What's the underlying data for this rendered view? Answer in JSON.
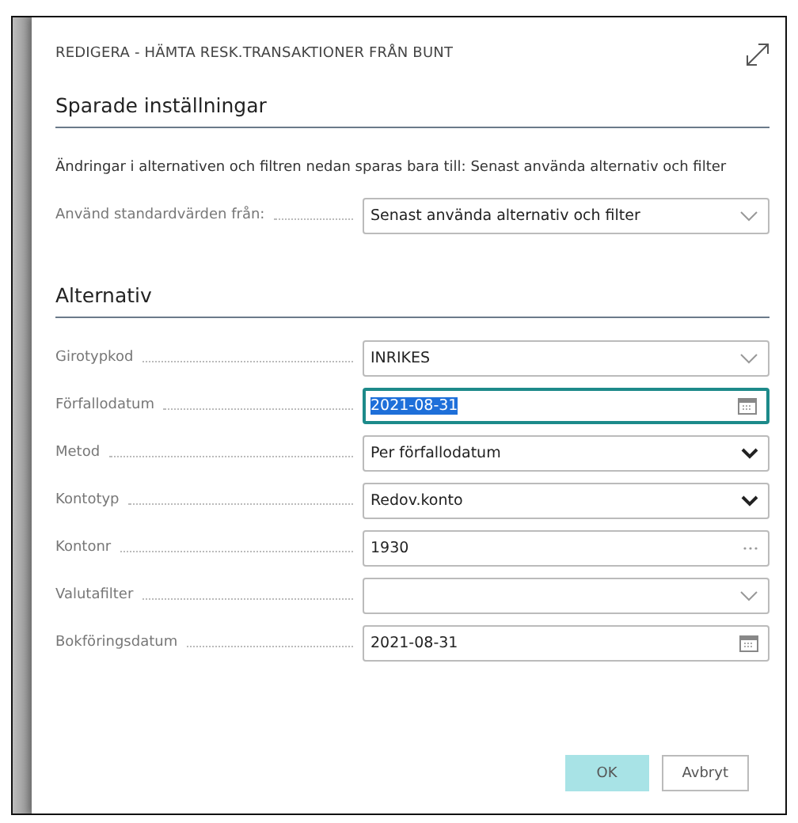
{
  "dialog": {
    "title": "REDIGERA - HÄMTA RESK.TRANSAKTIONER FRÅN BUNT"
  },
  "saved_settings": {
    "heading": "Sparade inställningar",
    "info": "Ändringar i alternativen och filtren nedan sparas bara till: Senast använda alternativ och filter",
    "default_field": {
      "label": "Använd standardvärden från:",
      "value": "Senast använda alternativ och filter",
      "kind": "dropdown"
    }
  },
  "options": {
    "heading": "Alternativ",
    "fields": [
      {
        "label": "Girotypkod",
        "value": "INRIKES",
        "kind": "dropdown",
        "focused": false
      },
      {
        "label": "Förfallodatum",
        "value": "2021-08-31",
        "kind": "date",
        "focused": true
      },
      {
        "label": "Metod",
        "value": "Per förfallodatum",
        "kind": "select",
        "focused": false
      },
      {
        "label": "Kontotyp",
        "value": "Redov.konto",
        "kind": "select",
        "focused": false
      },
      {
        "label": "Kontonr",
        "value": "1930",
        "kind": "lookup",
        "focused": false
      },
      {
        "label": "Valutafilter",
        "kind": "dropdown",
        "focused": false
      },
      {
        "label": "Bokföringsdatum",
        "value": "2021-08-31",
        "kind": "date",
        "focused": false
      }
    ]
  },
  "buttons": [
    {
      "label": "OK",
      "primary": true
    },
    {
      "label": "Avbryt",
      "primary": false
    }
  ]
}
